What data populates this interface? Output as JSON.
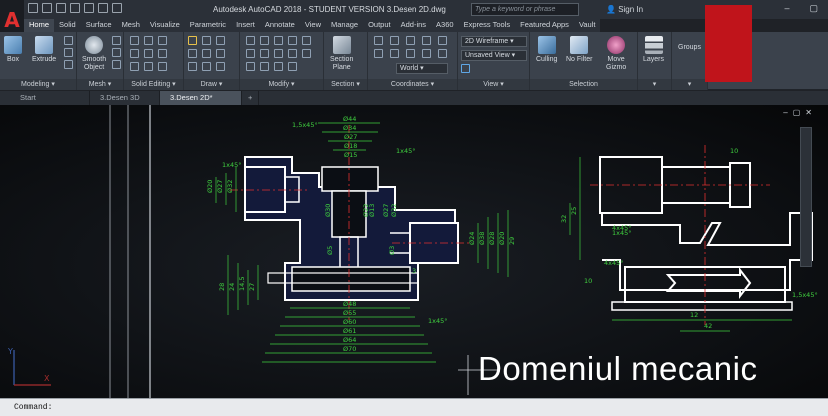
{
  "app": {
    "logo": "A",
    "title": "Autodesk AutoCAD 2018 - STUDENT VERSION    3.Desen 2D.dwg",
    "search_placeholder": "Type a keyword or phrase",
    "signin": "Sign In",
    "minimize": "–",
    "restore": "▢"
  },
  "ribbon_tabs": [
    "Home",
    "Solid",
    "Surface",
    "Mesh",
    "Visualize",
    "Parametric",
    "Insert",
    "Annotate",
    "View",
    "Manage",
    "Output",
    "Add-ins",
    "A360",
    "Express Tools",
    "Featured Apps",
    "Vault"
  ],
  "panels": {
    "modeling": {
      "title": "Modeling",
      "box": "Box",
      "extrude": "Extrude"
    },
    "mesh": {
      "title": "Mesh",
      "smooth": "Smooth\nObject"
    },
    "solid_editing": {
      "title": "Solid Editing"
    },
    "draw": {
      "title": "Draw"
    },
    "modify": {
      "title": "Modify"
    },
    "section": {
      "title": "Section",
      "section_plane": "Section\nPlane"
    },
    "coordinates": {
      "title": "Coordinates",
      "world": "World"
    },
    "view": {
      "title": "View",
      "visual_style": "2D Wireframe",
      "saved_view": "Unsaved View"
    },
    "selection": {
      "title": "Selection",
      "culling": "Culling",
      "no_filter": "No Filter",
      "move_gizmo": "Move\nGizmo"
    },
    "layers": {
      "label": "Layers"
    },
    "groups": {
      "label": "Groups"
    }
  },
  "file_tabs": [
    "Start",
    "3.Desen 3D",
    "3.Desen 2D*",
    "+"
  ],
  "view_controls": [
    "–",
    "▢",
    "✕"
  ],
  "drawing": {
    "dims": [
      "Ø44",
      "Ø34",
      "Ø27",
      "Ø18",
      "Ø15",
      "Ø48",
      "Ø55",
      "Ø60",
      "Ø61",
      "Ø64",
      "Ø70",
      "1x45°",
      "1x45°",
      "1x45°",
      "1,5x45°",
      "Ø32",
      "Ø27",
      "Ø20",
      "Ø38",
      "Ø24",
      "Ø28",
      "Ø20",
      "Ø13",
      "Ø22",
      "Ø27",
      "Ø32",
      "Ø30",
      "Ø5",
      "Ø3",
      "29",
      "14,5",
      "27",
      "24",
      "28",
      "3",
      "4x45°",
      "1x45°",
      "12",
      "42",
      "10",
      "10",
      "4x45°",
      "1,5x45°",
      "25",
      "32"
    ]
  },
  "overlay": "Domeniul mecanic",
  "ucs": {
    "y": "Y",
    "x": "X"
  },
  "command": {
    "prompt": "Command:"
  }
}
